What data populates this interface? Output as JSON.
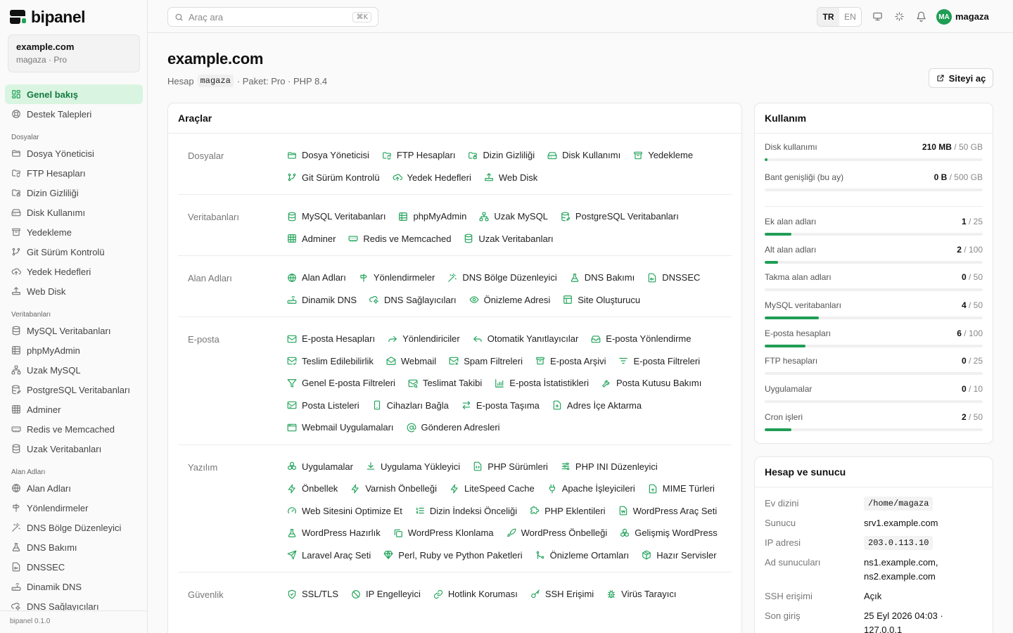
{
  "brand": {
    "name": "bipanel",
    "accent": "#1f9d55",
    "active_bg": "#d9f5e1"
  },
  "account": {
    "domain": "example.com",
    "subtitle": "magaza · Pro"
  },
  "sidebar": {
    "version": "bipanel 0.1.0",
    "items": [
      {
        "label": "Genel bakış",
        "icon": "dashboard-icon",
        "active": true
      },
      {
        "label": "Destek Talepleri",
        "icon": "lifebuoy-icon"
      }
    ],
    "sections": [
      {
        "title": "Dosyalar",
        "items": [
          {
            "label": "Dosya Yöneticisi",
            "icon": "folder-icon"
          },
          {
            "label": "FTP Hesapları",
            "icon": "folder-sync-icon"
          },
          {
            "label": "Dizin Gizliliği",
            "icon": "folder-lock-icon"
          },
          {
            "label": "Disk Kullanımı",
            "icon": "hard-drive-icon"
          },
          {
            "label": "Yedekleme",
            "icon": "archive-icon"
          },
          {
            "label": "Git Sürüm Kontrolü",
            "icon": "git-branch-icon"
          },
          {
            "label": "Yedek Hedefleri",
            "icon": "cloud-upload-icon"
          },
          {
            "label": "Web Disk",
            "icon": "upload-drive-icon"
          }
        ]
      },
      {
        "title": "Veritabanları",
        "items": [
          {
            "label": "MySQL Veritabanları",
            "icon": "database-icon"
          },
          {
            "label": "phpMyAdmin",
            "icon": "table-icon"
          },
          {
            "label": "Uzak MySQL",
            "icon": "network-icon"
          },
          {
            "label": "PostgreSQL Veritabanları",
            "icon": "database-edit-icon"
          },
          {
            "label": "Adminer",
            "icon": "grid-icon"
          },
          {
            "label": "Redis ve Memcached",
            "icon": "memory-icon"
          },
          {
            "label": "Uzak Veritabanları",
            "icon": "database-icon"
          }
        ]
      },
      {
        "title": "Alan Adları",
        "items": [
          {
            "label": "Alan Adları",
            "icon": "globe-icon"
          },
          {
            "label": "Yönlendirmeler",
            "icon": "signpost-icon"
          },
          {
            "label": "DNS Bölge Düzenleyici",
            "icon": "wand-icon"
          },
          {
            "label": "DNS Bakımı",
            "icon": "flask-icon"
          },
          {
            "label": "DNSSEC",
            "icon": "file-key-icon"
          },
          {
            "label": "Dinamik DNS",
            "icon": "router-icon"
          },
          {
            "label": "DNS Sağlayıcıları",
            "icon": "cloud-cog-icon"
          }
        ]
      }
    ]
  },
  "topbar": {
    "search_placeholder": "Araç ara",
    "shortcut": "⌘K",
    "languages": [
      "TR",
      "EN"
    ],
    "active_language": "TR",
    "user_initials": "MA",
    "user_name": "magaza"
  },
  "page": {
    "title": "example.com",
    "account_label": "Hesap",
    "account_code": "magaza",
    "meta": "· Paket: Pro · PHP 8.4",
    "open_site": "Siteyi aç"
  },
  "tools": {
    "title": "Araçlar",
    "groups": [
      {
        "label": "Dosyalar",
        "tools": [
          {
            "label": "Dosya Yöneticisi",
            "icon": "folder-icon"
          },
          {
            "label": "FTP Hesapları",
            "icon": "folder-sync-icon"
          },
          {
            "label": "Dizin Gizliliği",
            "icon": "folder-lock-icon"
          },
          {
            "label": "Disk Kullanımı",
            "icon": "hard-drive-icon"
          },
          {
            "label": "Yedekleme",
            "icon": "archive-icon"
          },
          {
            "label": "Git Sürüm Kontrolü",
            "icon": "git-branch-icon"
          },
          {
            "label": "Yedek Hedefleri",
            "icon": "cloud-upload-icon"
          },
          {
            "label": "Web Disk",
            "icon": "upload-drive-icon"
          }
        ]
      },
      {
        "label": "Veritabanları",
        "tools": [
          {
            "label": "MySQL Veritabanları",
            "icon": "database-icon"
          },
          {
            "label": "phpMyAdmin",
            "icon": "table-icon"
          },
          {
            "label": "Uzak MySQL",
            "icon": "network-icon"
          },
          {
            "label": "PostgreSQL Veritabanları",
            "icon": "database-edit-icon"
          },
          {
            "label": "Adminer",
            "icon": "grid-icon"
          },
          {
            "label": "Redis ve Memcached",
            "icon": "memory-icon"
          },
          {
            "label": "Uzak Veritabanları",
            "icon": "database-icon"
          }
        ]
      },
      {
        "label": "Alan Adları",
        "tools": [
          {
            "label": "Alan Adları",
            "icon": "globe-icon"
          },
          {
            "label": "Yönlendirmeler",
            "icon": "signpost-icon"
          },
          {
            "label": "DNS Bölge Düzenleyici",
            "icon": "wand-icon"
          },
          {
            "label": "DNS Bakımı",
            "icon": "flask-icon"
          },
          {
            "label": "DNSSEC",
            "icon": "file-key-icon"
          },
          {
            "label": "Dinamik DNS",
            "icon": "router-icon"
          },
          {
            "label": "DNS Sağlayıcıları",
            "icon": "cloud-cog-icon"
          },
          {
            "label": "Önizleme Adresi",
            "icon": "eye-icon"
          },
          {
            "label": "Site Oluşturucu",
            "icon": "layout-icon"
          }
        ]
      },
      {
        "label": "E-posta",
        "tools": [
          {
            "label": "E-posta Hesapları",
            "icon": "mail-icon"
          },
          {
            "label": "Yönlendiriciler",
            "icon": "forward-icon"
          },
          {
            "label": "Otomatik Yanıtlayıcılar",
            "icon": "reply-icon"
          },
          {
            "label": "E-posta Yönlendirme",
            "icon": "inbox-icon"
          },
          {
            "label": "Teslim Edilebilirlik",
            "icon": "mail-check-icon"
          },
          {
            "label": "Webmail",
            "icon": "mail-open-icon"
          },
          {
            "label": "Spam Filtreleri",
            "icon": "mail-x-icon"
          },
          {
            "label": "E-posta Arşivi",
            "icon": "archive-icon"
          },
          {
            "label": "E-posta Filtreleri",
            "icon": "filter-lines-icon"
          },
          {
            "label": "Genel E-posta Filtreleri",
            "icon": "funnel-icon"
          },
          {
            "label": "Teslimat Takibi",
            "icon": "mail-search-icon"
          },
          {
            "label": "E-posta İstatistikleri",
            "icon": "bar-chart-icon"
          },
          {
            "label": "Posta Kutusu Bakımı",
            "icon": "wrench-icon"
          },
          {
            "label": "Posta Listeleri",
            "icon": "mail-list-icon"
          },
          {
            "label": "Cihazları Bağla",
            "icon": "smartphone-icon"
          },
          {
            "label": "E-posta Taşıma",
            "icon": "arrows-swap-icon"
          },
          {
            "label": "Adres İçe Aktarma",
            "icon": "file-plus-icon"
          },
          {
            "label": "Webmail Uygulamaları",
            "icon": "app-window-icon"
          },
          {
            "label": "Gönderen Adresleri",
            "icon": "at-sign-icon"
          }
        ]
      },
      {
        "label": "Yazılım",
        "tools": [
          {
            "label": "Uygulamalar",
            "icon": "boxes-icon"
          },
          {
            "label": "Uygulama Yükleyici",
            "icon": "download-icon"
          },
          {
            "label": "PHP Sürümleri",
            "icon": "file-code-icon"
          },
          {
            "label": "PHP INI Düzenleyici",
            "icon": "sliders-icon"
          },
          {
            "label": "Önbellek",
            "icon": "zap-icon"
          },
          {
            "label": "Varnish Önbelleği",
            "icon": "zap-icon"
          },
          {
            "label": "LiteSpeed Cache",
            "icon": "zap-icon"
          },
          {
            "label": "Apache İşleyicileri",
            "icon": "plug-icon"
          },
          {
            "label": "MIME Türleri",
            "icon": "file-type-icon"
          },
          {
            "label": "Web Sitesini Optimize Et",
            "icon": "gauge-icon"
          },
          {
            "label": "Dizin İndeksi Önceliği",
            "icon": "list-ordered-icon"
          },
          {
            "label": "PHP Eklentileri",
            "icon": "puzzle-icon"
          },
          {
            "label": "WordPress Araç Seti",
            "icon": "wordpress-icon"
          },
          {
            "label": "WordPress Hazırlık",
            "icon": "flask-icon"
          },
          {
            "label": "WordPress Klonlama",
            "icon": "copy-icon"
          },
          {
            "label": "WordPress Önbelleği",
            "icon": "rocket-icon"
          },
          {
            "label": "Gelişmiş WordPress",
            "icon": "boxes-icon"
          },
          {
            "label": "Laravel Araç Seti",
            "icon": "send-icon"
          },
          {
            "label": "Perl, Ruby ve Python Paketleri",
            "icon": "gem-icon"
          },
          {
            "label": "Önizleme Ortamları",
            "icon": "git-merge-icon"
          },
          {
            "label": "Hazır Servisler",
            "icon": "package-icon"
          }
        ]
      },
      {
        "label": "Güvenlik",
        "tools": [
          {
            "label": "SSL/TLS",
            "icon": "shield-check-icon"
          },
          {
            "label": "IP Engelleyici",
            "icon": "ban-icon"
          },
          {
            "label": "Hotlink Koruması",
            "icon": "link-icon"
          },
          {
            "label": "SSH Erişimi",
            "icon": "key-icon"
          },
          {
            "label": "Virüs Tarayıcı",
            "icon": "bug-icon"
          }
        ]
      }
    ]
  },
  "usage": {
    "title": "Kullanım",
    "rows": [
      {
        "label": "Disk kullanımı",
        "used": "210 MB",
        "total": "50 GB",
        "ratio": 0.004,
        "big": true
      },
      {
        "label": "Bant genişliği (bu ay)",
        "used": "0 B",
        "total": "500 GB",
        "ratio": 0,
        "big": true
      },
      {
        "label": "Ek alan adları",
        "used": "1",
        "total": "25",
        "ratio": 0.04
      },
      {
        "label": "Alt alan adları",
        "used": "2",
        "total": "100",
        "ratio": 0.02
      },
      {
        "label": "Takma alan adları",
        "used": "0",
        "total": "50",
        "ratio": 0
      },
      {
        "label": "MySQL veritabanları",
        "used": "4",
        "total": "50",
        "ratio": 0.08
      },
      {
        "label": "E-posta hesapları",
        "used": "6",
        "total": "100",
        "ratio": 0.06
      },
      {
        "label": "FTP hesapları",
        "used": "0",
        "total": "25",
        "ratio": 0
      },
      {
        "label": "Uygulamalar",
        "used": "0",
        "total": "10",
        "ratio": 0
      },
      {
        "label": "Cron işleri",
        "used": "2",
        "total": "50",
        "ratio": 0.04
      }
    ]
  },
  "host": {
    "title": "Hesap ve sunucu",
    "rows": [
      {
        "key": "Ev dizini",
        "value": "/home/magaza",
        "code": true
      },
      {
        "key": "Sunucu",
        "value": "srv1.example.com"
      },
      {
        "key": "IP adresi",
        "value": "203.0.113.10",
        "code": true
      },
      {
        "key": "Ad sunucuları",
        "value": "ns1.example.com,\nns2.example.com"
      },
      {
        "key": "SSH erişimi",
        "value": "Açık"
      },
      {
        "key": "Son giriş",
        "value": "25 Eyl 2026 04:03 ·\n127.0.0.1"
      }
    ]
  }
}
